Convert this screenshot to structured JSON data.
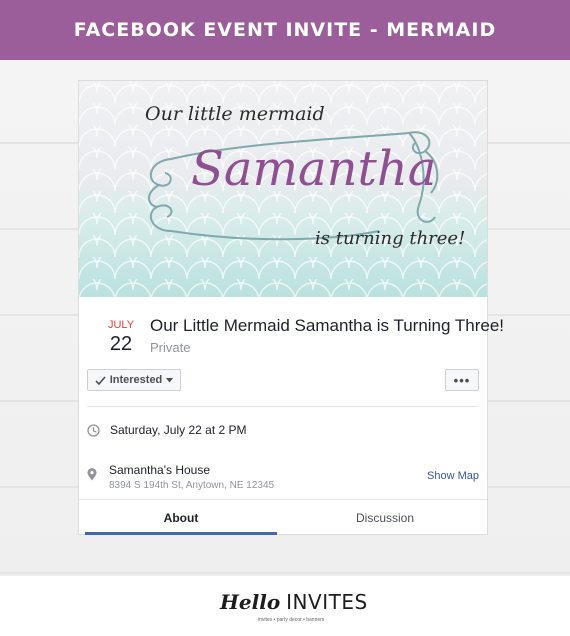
{
  "banner": {
    "title": "FACEBOOK EVENT INVITE - MERMAID"
  },
  "cover": {
    "line1": "Our little mermaid",
    "name": "Samantha",
    "line3": "is turning three!",
    "colors": {
      "name": "#8e4f93",
      "frame": "#7fa9ad",
      "scales_top": "#f1f1f3",
      "scales_bottom": "#b9e1de"
    }
  },
  "event": {
    "month": "JULY",
    "day": "22",
    "title": "Our Little Mermaid Samantha is Turning Three!",
    "privacy": "Private"
  },
  "actions": {
    "interested_label": "Interested",
    "more_label": "•••"
  },
  "details": {
    "time_text": "Saturday, July 22 at 2 PM",
    "place_name": "Samantha's House",
    "place_address": "8394 S 194th St, Anytown, NE 12345",
    "show_map_label": "Show Map",
    "icons": [
      "clock-icon",
      "location-pin-icon",
      "check-icon",
      "caret-down-icon"
    ]
  },
  "tabs": [
    {
      "label": "About",
      "active": true
    },
    {
      "label": "Discussion",
      "active": false
    }
  ],
  "brand": {
    "hello": "Hello",
    "invites": "INVITES",
    "tagline": "invites • party decor • banners",
    "accent": "#9b5e9a",
    "link_color": "#365899"
  }
}
